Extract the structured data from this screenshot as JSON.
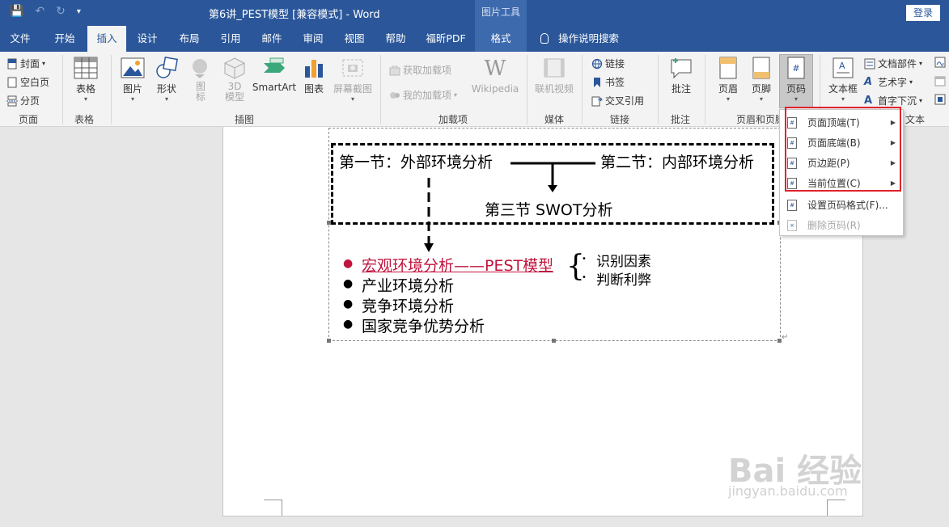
{
  "titlebar": {
    "doc_title": "第6讲_PEST模型 [兼容模式] - Word",
    "context_title": "图片工具",
    "login": "登录"
  },
  "tabs": [
    "文件",
    "开始",
    "插入",
    "设计",
    "布局",
    "引用",
    "邮件",
    "审阅",
    "视图",
    "帮助",
    "福昕PDF",
    "格式"
  ],
  "tell_me": "操作说明搜索",
  "ribbon": {
    "pages": {
      "cover": "封面",
      "blank": "空白页",
      "break": "分页",
      "label": "页面"
    },
    "tables": {
      "table": "表格",
      "label": "表格"
    },
    "illustrations": {
      "picture": "图片",
      "shapes": "形状",
      "icons": "图标",
      "model3d": "3D模型",
      "smartart": "SmartArt",
      "chart": "图表",
      "screenshot": "屏幕截图",
      "label": "插图"
    },
    "addins": {
      "get": "获取加载项",
      "my": "我的加载项",
      "wikipedia": "Wikipedia",
      "label": "加载项"
    },
    "media": {
      "video": "联机视频",
      "label": "媒体"
    },
    "links": {
      "link": "链接",
      "bookmark": "书签",
      "crossref": "交叉引用",
      "label": "链接"
    },
    "comments": {
      "comment": "批注",
      "label": "批注"
    },
    "header_footer": {
      "header": "页眉",
      "footer": "页脚",
      "pagenum": "页码",
      "label": "页眉和页脚"
    },
    "text": {
      "textbox": "文本框",
      "quickparts": "文档部件",
      "wordart": "艺术字",
      "dropcap": "首字下沉",
      "label": "文本"
    }
  },
  "menu": {
    "items": [
      {
        "label": "页面顶端(T)"
      },
      {
        "label": "页面底端(B)"
      },
      {
        "label": "页边距(P)"
      },
      {
        "label": "当前位置(C)"
      },
      {
        "label": "设置页码格式(F)..."
      },
      {
        "label": "删除页码(R)"
      }
    ]
  },
  "document": {
    "section1": "第一节：外部环境分析",
    "section2": "第二节：内部环境分析",
    "section3": "第三节  SWOT分析",
    "bullets": [
      "宏观环境分析——PEST模型",
      "产业环境分析",
      "竞争环境分析",
      "国家竞争优势分析"
    ],
    "sub_items": [
      "识别因素",
      "判断利弊"
    ]
  },
  "watermark": {
    "main": "Bai 经验",
    "url": "jingyan.baidu.com"
  },
  "colors": {
    "accent": "#2b579a",
    "highlight": "#e0212d",
    "pest_red": "#c0143c"
  }
}
